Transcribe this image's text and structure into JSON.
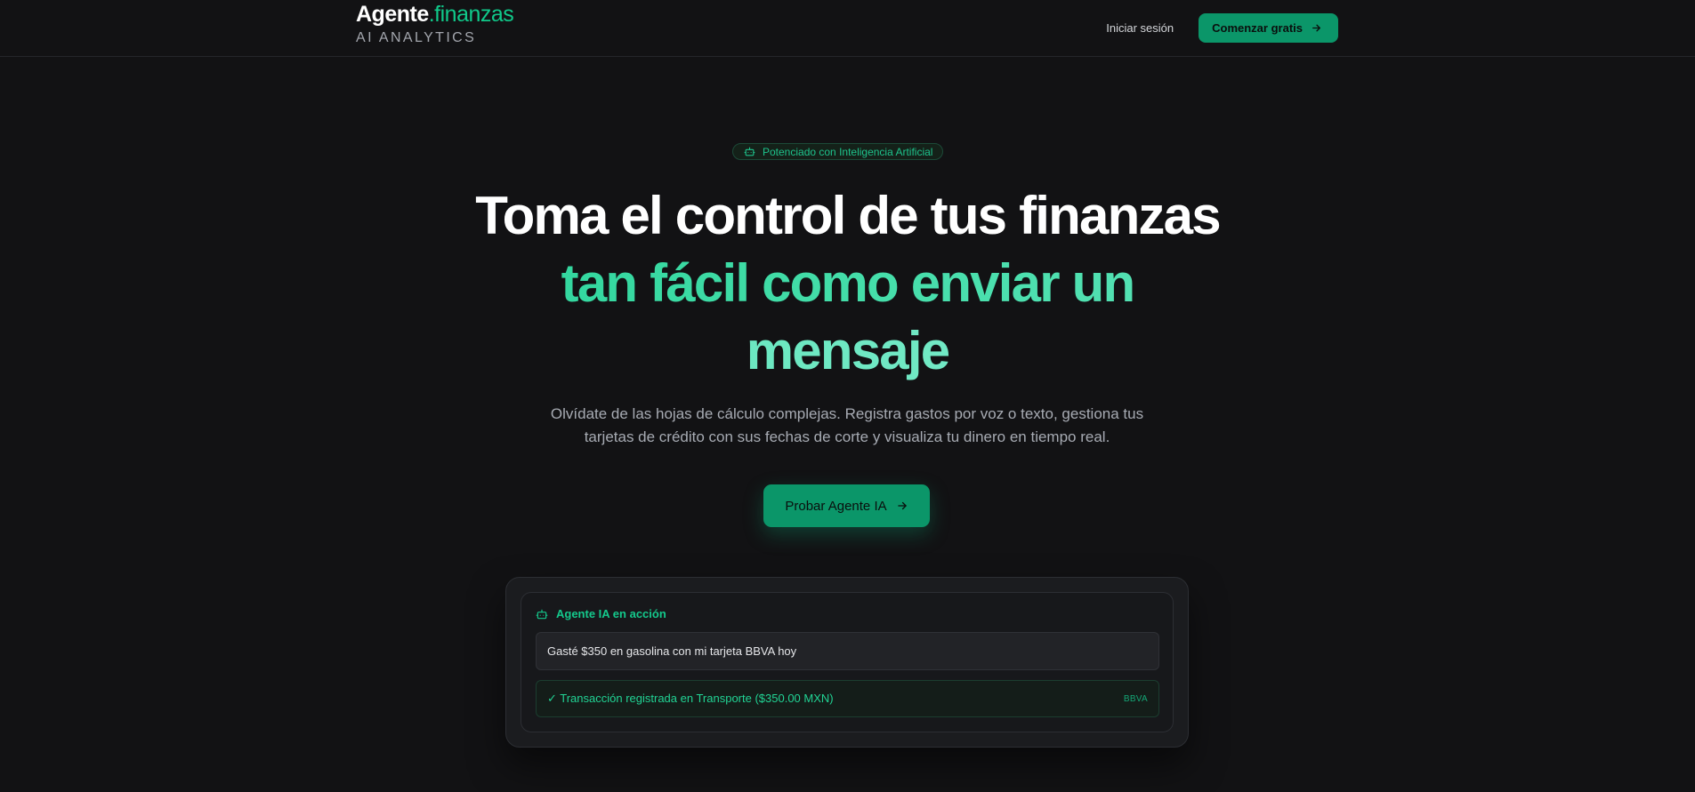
{
  "nav": {
    "brand_primary": "Agente",
    "brand_secondary": ".finanzas",
    "brand_tagline": "AI ANALYTICS",
    "login_label": "Iniciar sesión",
    "start_label": "Comenzar gratis"
  },
  "hero": {
    "badge_icon": "robot-icon",
    "badge_text": "Potenciado con Inteligencia Artificial",
    "headline_line1": "Toma el control de tus finanzas",
    "headline_line2": "tan fácil como enviar un",
    "headline_line3": "mensaje",
    "description": "Olvídate de las hojas de cálculo complejas. Registra gastos por voz o texto, gestiona tus tarjetas de crédito con sus fechas de corte y visualiza tu dinero en tiempo real.",
    "cta_label": "Probar Agente IA"
  },
  "demo": {
    "title_icon": "robot-icon",
    "title": "Agente IA en acción",
    "message": "Gasté $350 en gasolina con mi tarjeta BBVA hoy",
    "result": "✓ Transacción registrada en Transporte ($350.00 MXN)",
    "result_tag": "BBVA"
  },
  "colors": {
    "background": "#121214",
    "accent": "#0b9669",
    "accent_text": "#14c98c",
    "accent_light": "#6fe8c4"
  }
}
